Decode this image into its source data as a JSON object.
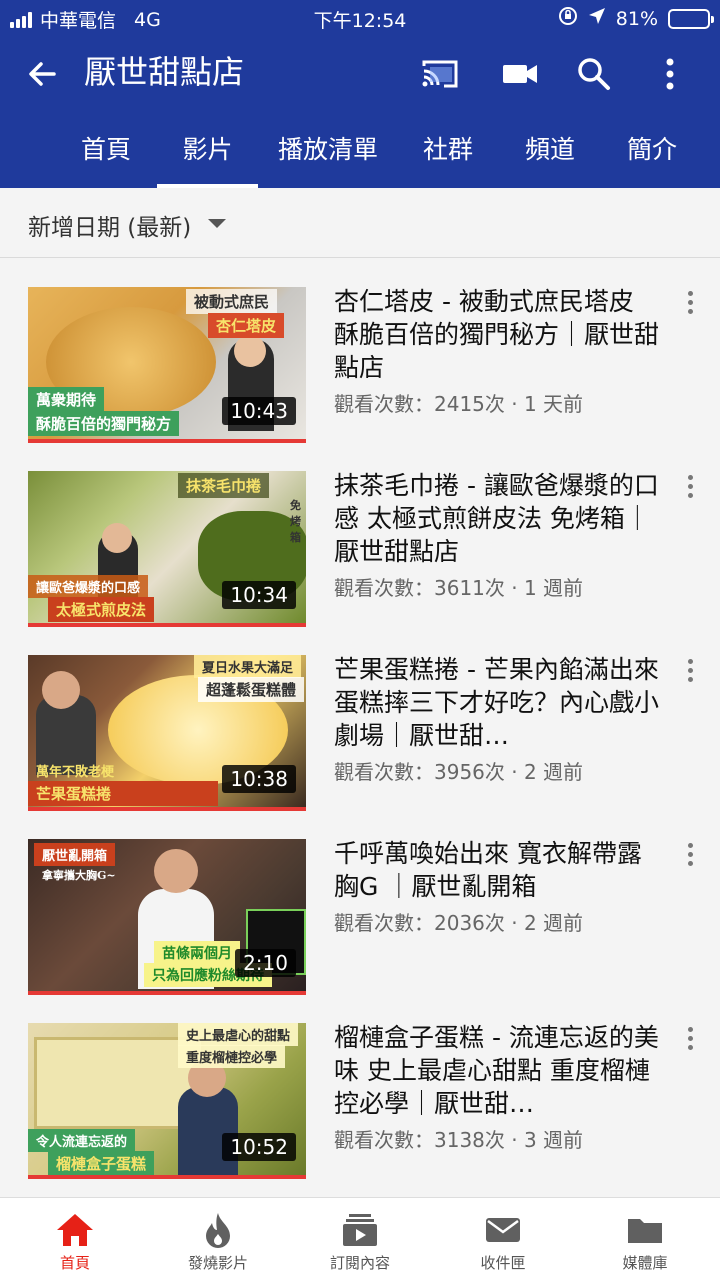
{
  "status": {
    "carrier": "中華電信",
    "network": "4G",
    "time": "下午12:54",
    "battery": "81%",
    "battery_level": 0.81
  },
  "appbar": {
    "title": "厭世甜點店"
  },
  "tabs": [
    "首頁",
    "影片",
    "播放清單",
    "社群",
    "頻道",
    "簡介"
  ],
  "active_tab": 1,
  "sort": {
    "label": "新增日期 (最新)"
  },
  "videos": [
    {
      "title": "杏仁塔皮 - 被動式庶民塔皮 酥脆百倍的獨門秘方｜厭世甜點店",
      "meta": "觀看次數：2415次 · 1 天前",
      "duration": "10:43",
      "captions": [
        "被動式庶民",
        "杏仁塔皮",
        "萬衆期待",
        "酥脆百倍的獨門秘方"
      ]
    },
    {
      "title": "抹茶毛巾捲 - 讓歐爸爆漿的口感 太極式煎餅皮法 免烤箱｜厭世甜點店",
      "meta": "觀看次數：3611次 · 1 週前",
      "duration": "10:34",
      "captions": [
        "抹茶毛巾捲",
        "免烤箱",
        "讓歐爸爆漿的口感",
        "太極式煎皮法"
      ]
    },
    {
      "title": "芒果蛋糕捲 - 芒果內餡滿出來 蛋糕摔三下才好吃？內心戲小劇場｜厭世甜…",
      "meta": "觀看次數：3956次 · 2 週前",
      "duration": "10:38",
      "captions": [
        "夏日水果大滿足",
        "超蓬鬆蛋糕體",
        "萬年不敗老梗",
        "芒果蛋糕捲"
      ]
    },
    {
      "title": "千呼萬喚始出來 寬衣解帶露胸G ｜厭世亂開箱",
      "meta": "觀看次數：2036次 · 2 週前",
      "duration": "2:10",
      "captions": [
        "厭世亂開箱",
        "拿寧攜大胸G~",
        "苗條兩個月",
        "只為回應粉絲期待"
      ]
    },
    {
      "title": "榴槤盒子蛋糕 - 流連忘返的美味 史上最虐心甜點 重度榴槤控必學｜厭世甜…",
      "meta": "觀看次數：3138次 · 3 週前",
      "duration": "10:52",
      "captions": [
        "史上最虐心的甜點",
        "重度榴槤控必學",
        "令人流連忘返的",
        "榴槤盒子蛋糕"
      ]
    }
  ],
  "bottom_nav": [
    "首頁",
    "發燒影片",
    "訂閱內容",
    "收件匣",
    "媒體庫"
  ],
  "colors": {
    "brand_blue": "#1f3a9c",
    "accent_red": "#e62117"
  }
}
